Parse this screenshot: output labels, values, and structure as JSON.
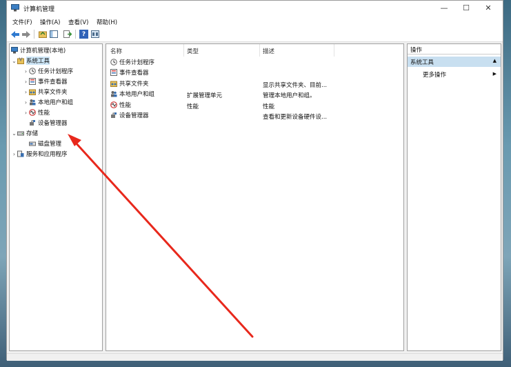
{
  "window": {
    "title": "计算机管理",
    "min_glyph": "—",
    "max_glyph": "☐",
    "close_glyph": "✕"
  },
  "menu": [
    "文件(F)",
    "操作(A)",
    "查看(V)",
    "帮助(H)"
  ],
  "toolbar": {
    "back": "back-icon",
    "forward": "forward-icon",
    "up": "up-folder-icon",
    "show_tree": "show-tree-icon",
    "export": "export-icon",
    "help": "help-icon",
    "view": "view-icon",
    "help_glyph": "?"
  },
  "tree": {
    "root": "计算机管理(本地)",
    "system_tools": "系统工具",
    "task_scheduler": "任务计划程序",
    "event_viewer": "事件查看器",
    "shared_folders": "共享文件夹",
    "local_users": "本地用户和组",
    "performance": "性能",
    "device_manager": "设备管理器",
    "storage": "存储",
    "disk_management": "磁盘管理",
    "services_apps": "服务和应用程序"
  },
  "list": {
    "headers": {
      "name": "名称",
      "type": "类型",
      "desc": "描述"
    },
    "rows": [
      {
        "name": "任务计划程序",
        "type": "",
        "desc": ""
      },
      {
        "name": "事件查看器",
        "type": "",
        "desc": ""
      },
      {
        "name": "共享文件夹",
        "type": "",
        "desc": "显示共享文件夹、目前..."
      },
      {
        "name": "本地用户和组",
        "type": "扩展管理单元",
        "desc": "管理本地用户和组。"
      },
      {
        "name": "性能",
        "type": "性能",
        "desc": "性能"
      },
      {
        "name": "设备管理器",
        "type": "",
        "desc": "查看和更新设备硬件设..."
      }
    ]
  },
  "actions": {
    "header": "操作",
    "section": "系统工具",
    "more": "更多操作",
    "collapse_glyph": "▲",
    "more_glyph": "▶"
  },
  "colors": {
    "accent_selection": "#cde6f7",
    "annotation_arrow": "#e8281c"
  }
}
